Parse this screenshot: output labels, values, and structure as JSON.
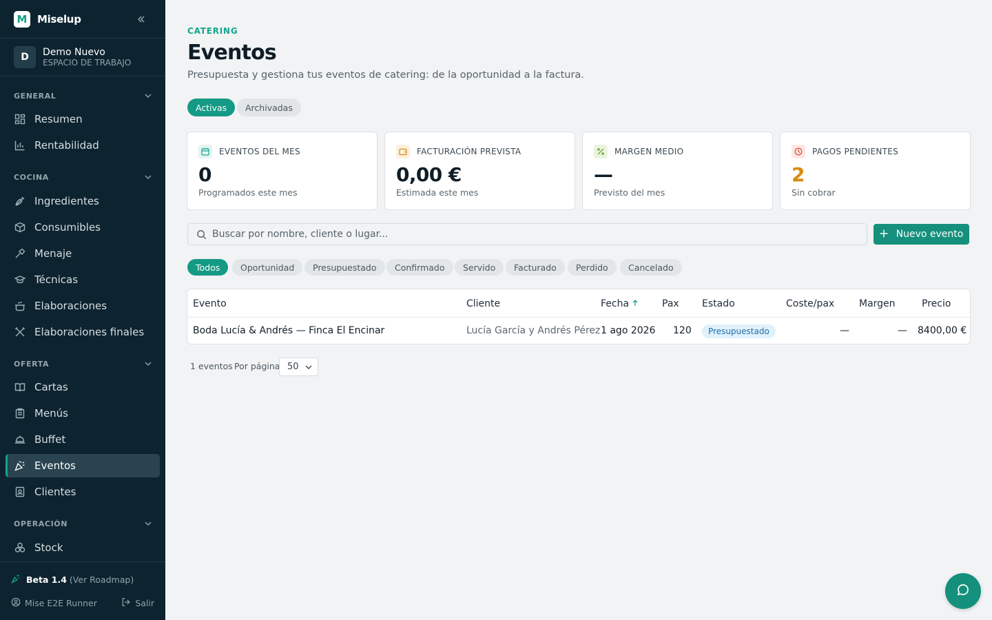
{
  "brand": {
    "name": "Miselup",
    "logo_letter": "M"
  },
  "workspace": {
    "initial": "D",
    "name": "Demo Nuevo",
    "label": "ESPACIO DE TRABAJO"
  },
  "sidebar": {
    "sections": [
      {
        "title": "GENERAL",
        "items": [
          {
            "label": "Resumen",
            "icon": "grid-icon"
          },
          {
            "label": "Rentabilidad",
            "icon": "bar-chart-icon"
          }
        ]
      },
      {
        "title": "COCINA",
        "items": [
          {
            "label": "Ingredientes",
            "icon": "carrot-icon"
          },
          {
            "label": "Consumibles",
            "icon": "package-icon"
          },
          {
            "label": "Menaje",
            "icon": "tools-icon"
          },
          {
            "label": "Técnicas",
            "icon": "graduation-cap-icon"
          },
          {
            "label": "Elaboraciones",
            "icon": "cooking-pot-icon"
          },
          {
            "label": "Elaboraciones finales",
            "icon": "utensils-icon"
          }
        ]
      },
      {
        "title": "OFERTA",
        "items": [
          {
            "label": "Cartas",
            "icon": "book-open-icon"
          },
          {
            "label": "Menús",
            "icon": "clipboard-icon"
          },
          {
            "label": "Buffet",
            "icon": "cloche-icon"
          },
          {
            "label": "Eventos",
            "icon": "party-popper-icon",
            "active": true
          },
          {
            "label": "Clientes",
            "icon": "contact-icon"
          }
        ]
      },
      {
        "title": "OPERACIÓN",
        "items": [
          {
            "label": "Stock",
            "icon": "boxes-icon"
          }
        ]
      }
    ],
    "footer": {
      "beta_version": "Beta 1.4",
      "roadmap_link": "(Ver Roadmap)",
      "user": "Mise E2E Runner",
      "logout": "Salir"
    }
  },
  "header": {
    "eyebrow": "CATERING",
    "title": "Eventos",
    "subtitle": "Presupuesta y gestiona tus eventos de catering: de la oportunidad a la factura."
  },
  "view_tabs": [
    {
      "label": "Activas",
      "active": true
    },
    {
      "label": "Archivadas",
      "active": false
    }
  ],
  "kpis": [
    {
      "title": "EVENTOS DEL MES",
      "value": "0",
      "caption": "Programados este mes",
      "icon": "calendar-icon",
      "accent": "#15a58c"
    },
    {
      "title": "FACTURACIÓN PREVISTA",
      "value": "0,00 €",
      "caption": "Estimada este mes",
      "icon": "wallet-icon",
      "accent": "#d48a1c"
    },
    {
      "title": "MARGEN MEDIO",
      "value": "—",
      "caption": "Previsto del mes",
      "icon": "percent-icon",
      "accent": "#5a9a2a"
    },
    {
      "title": "PAGOS PENDIENTES",
      "value": "2",
      "caption": "Sin cobrar",
      "icon": "clock-icon",
      "accent": "#d84a3a",
      "value_color": "#d98a0c"
    }
  ],
  "search": {
    "placeholder": "Buscar por nombre, cliente o lugar..."
  },
  "new_event_button": "Nuevo evento",
  "status_filters": [
    {
      "label": "Todos",
      "active": true
    },
    {
      "label": "Oportunidad"
    },
    {
      "label": "Presupuestado"
    },
    {
      "label": "Confirmado"
    },
    {
      "label": "Servido"
    },
    {
      "label": "Facturado"
    },
    {
      "label": "Perdido"
    },
    {
      "label": "Cancelado"
    }
  ],
  "table": {
    "columns": [
      "Evento",
      "Cliente",
      "Fecha",
      "Pax",
      "Estado",
      "Coste/pax",
      "Margen",
      "Precio"
    ],
    "sort": {
      "column": "Fecha",
      "direction": "asc"
    },
    "rows": [
      {
        "evento": "Boda Lucía & Andrés — Finca El Encinar",
        "cliente": "Lucía García y Andrés Pérez",
        "fecha": "1 ago 2026",
        "pax": "120",
        "estado": "Presupuestado",
        "coste_pax": "—",
        "margen": "—",
        "precio": "8400,00 €"
      }
    ]
  },
  "pagination": {
    "count_text": "1 eventos",
    "per_page_label": "Por página",
    "per_page_value": "50"
  },
  "colors": {
    "brand": "#15907c",
    "sidebar_bg": "#0d2430",
    "page_bg": "#f1f3f4"
  }
}
